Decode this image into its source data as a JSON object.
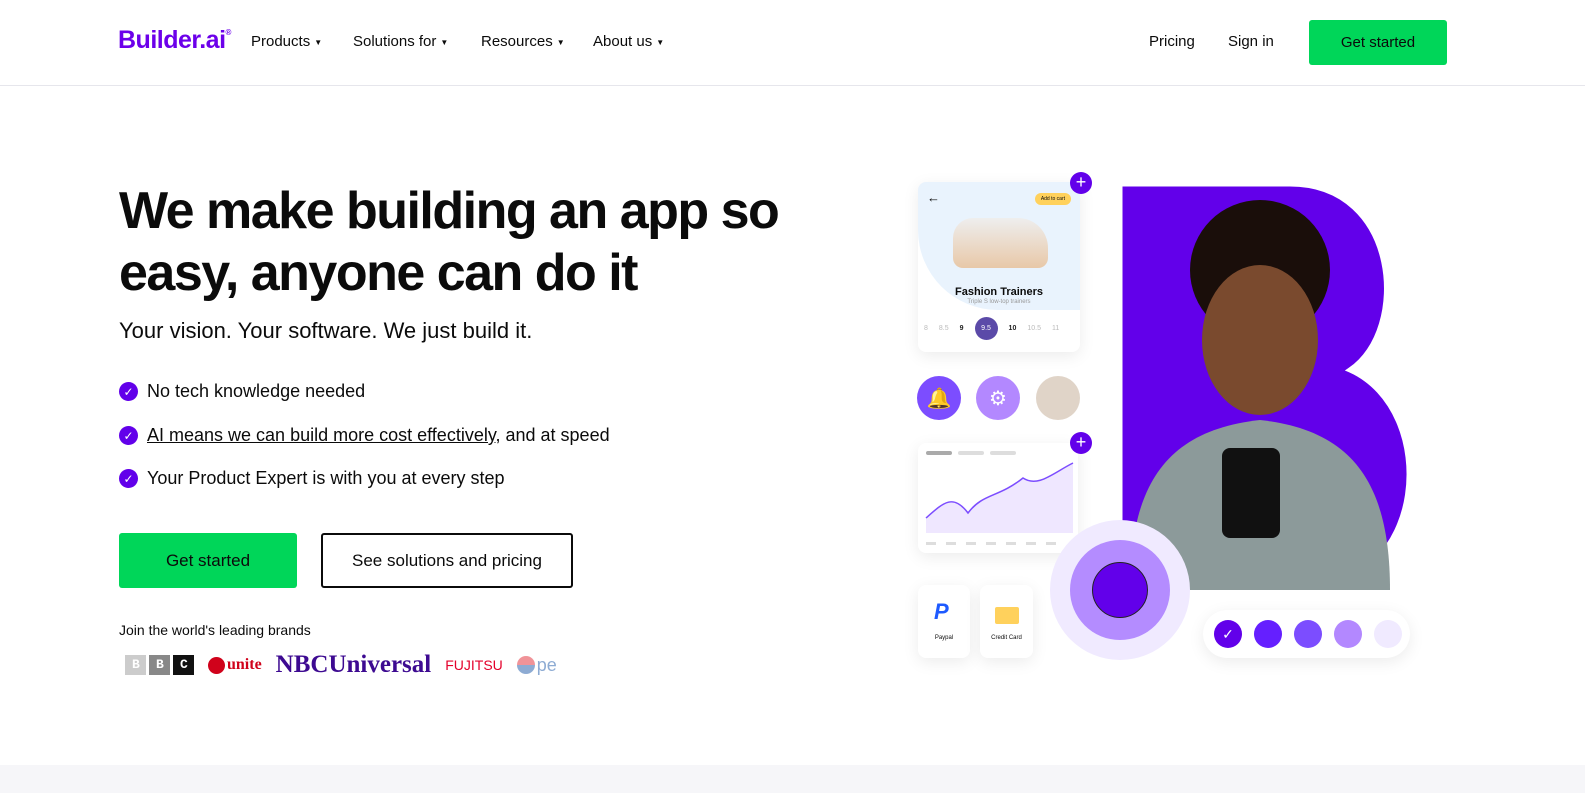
{
  "nav": {
    "logo": "Builder.ai",
    "items": [
      {
        "label": "Products"
      },
      {
        "label": "Solutions for"
      },
      {
        "label": "Resources"
      },
      {
        "label": "About us"
      }
    ],
    "pricing": "Pricing",
    "signin": "Sign in",
    "get_started": "Get started"
  },
  "hero": {
    "headline": "We make building an app so easy, anyone can do it",
    "subtitle": "Your vision. Your software. We just build it.",
    "bullets": [
      {
        "text": "No tech knowledge needed"
      },
      {
        "link": "AI means we can build more cost effectively",
        "text": ", and at speed"
      },
      {
        "text": "Your Product Expert is with you at every step"
      }
    ],
    "cta_primary": "Get started",
    "cta_secondary": "See solutions and pricing",
    "brands_label": "Join the world's leading brands",
    "brands": [
      "BBC",
      "unite",
      "NBCUniversal",
      "FUJITSU",
      "pepsi"
    ]
  },
  "illustration": {
    "add_to_cart": "Add to cart",
    "product_title": "Fashion Trainers",
    "product_sub": "Triple S low-top trainers",
    "sizes": [
      "8",
      "8.5",
      "9",
      "9.5",
      "10",
      "10.5",
      "11"
    ],
    "selected_size": "9.5",
    "payment": [
      "Paypal",
      "Credit Card"
    ]
  },
  "colors": {
    "accent": "#6200ea",
    "cta": "#00d659"
  }
}
